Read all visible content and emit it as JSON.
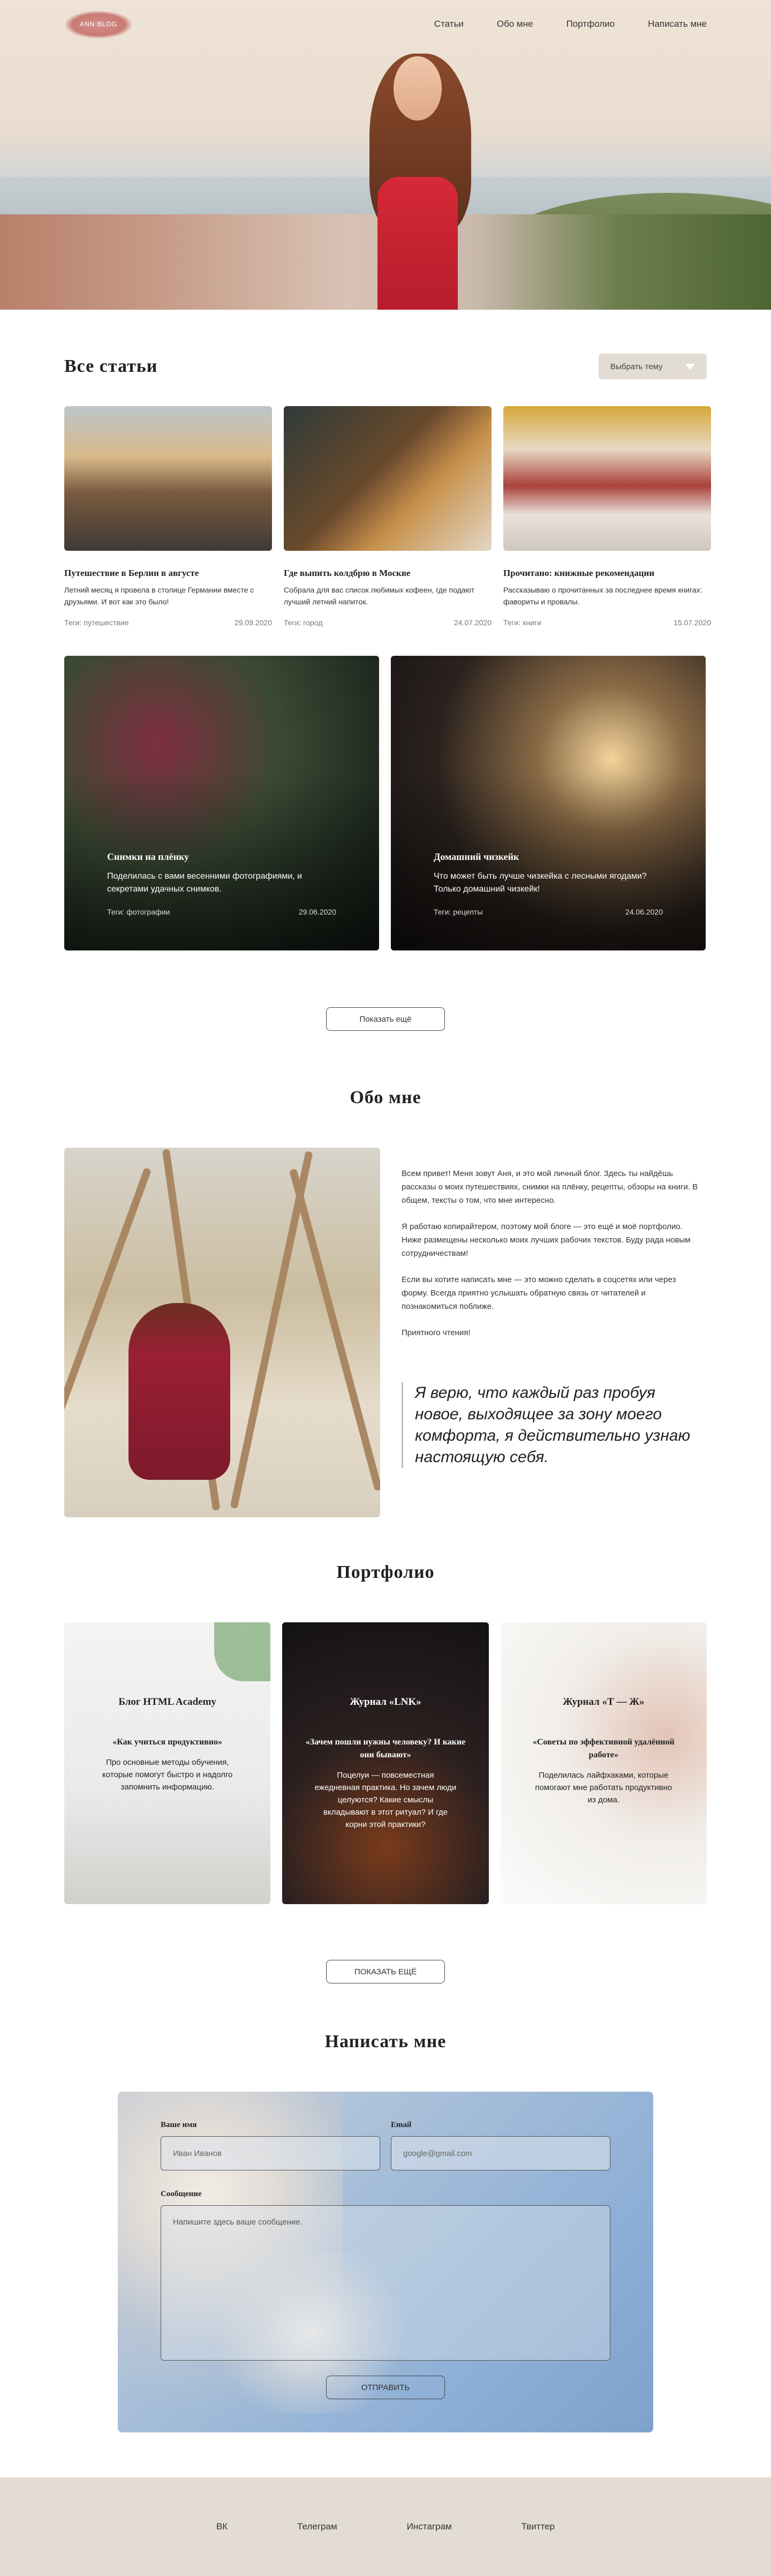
{
  "header": {
    "logo_text": "ANN BLOG",
    "nav": [
      "Статьи",
      "Обо мне",
      "Портфолио",
      "Написать мне"
    ]
  },
  "articles": {
    "title": "Все статьи",
    "filter_label": "Выбрать тему",
    "small": [
      {
        "title": "Путешествие в Берлин в августе",
        "text": "Летний месяц я провела в столице Германии вместе с друзьями. И вот как это было!",
        "tags": "Теги: путешествие",
        "date": "29.09.2020"
      },
      {
        "title": "Где выпить колдбрю в Москве",
        "text": "Собрала для вас список любимых кофеен, где подают лучший летний напиток.",
        "tags": "Теги: город",
        "date": "24.07.2020"
      },
      {
        "title": "Прочитано: книжные рекомендации",
        "text": "Рассказываю о прочитанных за последнее время книгах: фавориты и провалы.",
        "tags": "Теги: книги",
        "date": "15.07.2020"
      }
    ],
    "big": [
      {
        "title": "Снимки на плёнку",
        "text": "Поделилась с вами весенними фотографиями, и секретами удачных снимков.",
        "tags": "Теги: фотографии",
        "date": "29.06.2020"
      },
      {
        "title": "Домашний чизкейк",
        "text": "Что может быть лучше чизкейка с лесными ягодами? Только домашний чизкейк!",
        "tags": "Теги: рецепты",
        "date": "24.06.2020"
      }
    ],
    "more_button": "Показать ещё"
  },
  "about": {
    "title": "Обо мне",
    "paragraphs": [
      "Всем привет! Меня зовут Аня, и это мой личный блог. Здесь ты найдёшь рассказы о моих путешествиях, снимки на плёнку, рецепты, обзоры на книги. В общем, тексты о том, что мне интересно.",
      "Я работаю копирайтером, поэтому мой блоге — это ещё и моё портфолио. Ниже размещены несколько моих лучших рабочих текстов. Буду рада новым сотрудничествам!",
      "Если вы хотите написать мне — это можно сделать в соцсетях или через форму. Всегда приятно услышать обратную связь от читателей и познакомиться поближе.",
      "Приятного чтения!"
    ],
    "quote": "Я верю, что каждый раз пробуя новое, выходящее за зону моего комфорта, я действительно узнаю настоящую себя."
  },
  "portfolio": {
    "title": "Портфолио",
    "items": [
      {
        "title": "Блог HTML Academy",
        "subtitle": "«Как учиться продуктивно»",
        "text": "Про основные методы обучения, которые помогут быстро и надолго запомнить информацию."
      },
      {
        "title": "Журнал «LNK»",
        "subtitle": "«Зачем пошли нужны человеку? И какие они бывают»",
        "text": "Поцелуи — повсеместная ежедневная практика. Но зачем люди целуются? Какие смыслы вкладывают в этот ритуал? И где корни этой практики?"
      },
      {
        "title": "Журнал «Т — Ж»",
        "subtitle": "«Советы по эффективной удалённой работе»",
        "text": "Поделилась лайфхаками, которые помогают мне работать продуктивно из дома."
      }
    ],
    "more_button": "ПОКАЗАТЬ ЕЩЁ"
  },
  "contact": {
    "title": "Написать мне",
    "name_label": "Ваше имя",
    "name_placeholder": "Иван Иванов",
    "email_label": "Email",
    "email_placeholder": "google@gmail.com",
    "message_label": "Сообщение",
    "message_placeholder": "Напишите здесь ваше сообщение.",
    "send_button": "ОТПРАВИТЬ"
  },
  "footer": {
    "links": [
      "ВК",
      "Телеграм",
      "Инстаграм",
      "Твиттер"
    ]
  }
}
